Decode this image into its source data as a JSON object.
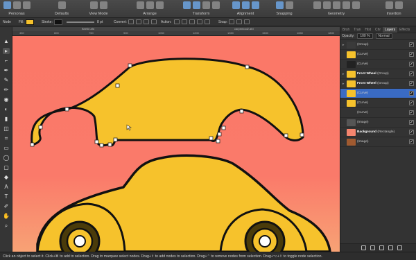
{
  "toolbar": {
    "personas": "Personas",
    "defaults": "Defaults",
    "view_mode": "View Mode",
    "arrange": "Arrange",
    "transform": "Transform",
    "alignment": "Alignment",
    "snapping": "Snapping",
    "geometry": "Geometry",
    "insertion": "Insertion"
  },
  "context": {
    "tool": "Node",
    "fill_label": "Fill:",
    "stroke_label": "Stroke:",
    "stroke_value": "8 pt",
    "convert_label": "Convert:",
    "action_label": "Action:",
    "snap_label": "Snap:"
  },
  "doc_tabs": [
    "Beetle.afd",
    "carpentool2.afd"
  ],
  "ruler_labels": [
    "450",
    "600",
    "750",
    "900",
    "1050",
    "1200",
    "1350",
    "1500",
    "1650",
    "1800"
  ],
  "panel": {
    "tabs": [
      "Brsh",
      "Tran",
      "Hist",
      "Chr",
      "Layers",
      "Effects"
    ],
    "active_tab": "Layers",
    "opacity_label": "Opacity:",
    "opacity_value": "100 %",
    "blend_mode": "Normal",
    "layers": [
      {
        "name": "(Group)",
        "bold": "",
        "thumb": "#3a3a3a",
        "expand": "▸",
        "checked": "✓",
        "selected": false
      },
      {
        "name": "(Curve)",
        "bold": "",
        "thumb": "#f6c22c",
        "expand": "",
        "checked": "✓",
        "selected": false
      },
      {
        "name": "(Curve)",
        "bold": "",
        "thumb": "#222",
        "expand": "",
        "checked": "✓",
        "selected": false
      },
      {
        "name": "(Group)",
        "bold": "Front Wheel",
        "thumb": "#f6c22c",
        "expand": "▸",
        "checked": "✓",
        "selected": false
      },
      {
        "name": "(Group)",
        "bold": "Front Wheel",
        "thumb": "#f6c22c",
        "expand": "▸",
        "checked": "✓",
        "selected": false
      },
      {
        "name": "(Curve)",
        "bold": "",
        "thumb": "#f6c22c",
        "expand": "",
        "checked": "✓",
        "selected": true
      },
      {
        "name": "(Curve)",
        "bold": "",
        "thumb": "#f6c22c",
        "expand": "",
        "checked": "✓",
        "selected": false
      },
      {
        "name": "(Curve)",
        "bold": "",
        "thumb": "#333",
        "expand": "",
        "checked": "✓",
        "selected": false
      },
      {
        "name": "(Image)",
        "bold": "",
        "thumb": "#555",
        "expand": "",
        "checked": "✓",
        "selected": false
      },
      {
        "name": "(Rectangle)",
        "bold": "Background",
        "thumb": "#f5856e",
        "expand": "",
        "checked": "✓",
        "selected": false
      },
      {
        "name": "(Image)",
        "bold": "",
        "thumb": "#a05a30",
        "expand": "",
        "checked": "✓",
        "selected": false
      }
    ]
  },
  "status": {
    "text": "Click an object to select it. Click+⌘ to add to selection. Drag to marquee select nodes. Drag+⇧ to add nodes to selection. Drag+⌃ to remove nodes from selection. Drag+⌥+⇧ to toggle node selection."
  },
  "colors": {
    "car_fill": "#f6c22c",
    "outline": "#111111",
    "background_top": "#fb7868",
    "background_bottom": "#f8a275",
    "selection": "#3a6bc4"
  }
}
